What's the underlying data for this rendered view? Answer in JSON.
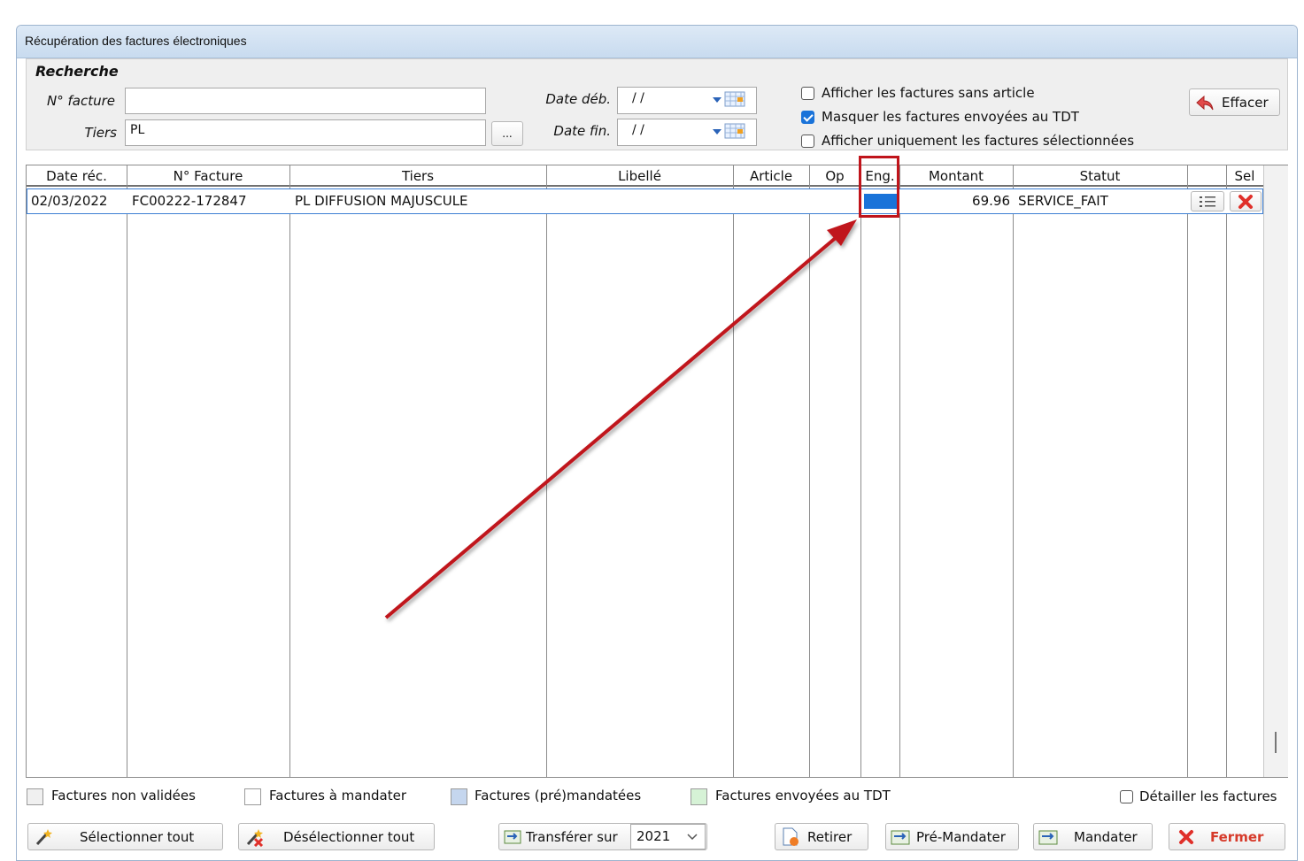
{
  "window": {
    "title": "Récupération des factures électroniques"
  },
  "search": {
    "section_title": "Recherche",
    "invoice_label": "N° facture",
    "invoice_value": "",
    "tiers_label": "Tiers",
    "tiers_value": "PL",
    "browse_label": "...",
    "date_start_label": "Date déb.",
    "date_start_value": "/ /",
    "date_end_label": "Date fin.",
    "date_end_value": "/ /",
    "clear_label": "Effacer",
    "options": [
      {
        "label": "Afficher les factures sans article",
        "checked": false
      },
      {
        "label": "Masquer les factures envoyées au TDT",
        "checked": true
      },
      {
        "label": "Afficher uniquement les factures sélectionnées",
        "checked": false
      }
    ]
  },
  "table": {
    "columns": [
      "Date réc.",
      "N° Facture",
      "Tiers",
      "Libellé",
      "Article",
      "Op",
      "Eng.",
      "Montant",
      "Statut",
      "",
      "Sel"
    ],
    "rows": [
      {
        "date": "02/03/2022",
        "invoice": "FC00222-172847",
        "tiers": "PL DIFFUSION MAJUSCULE",
        "libelle": "",
        "article": "",
        "op": "",
        "eng": "",
        "montant": "69.96",
        "statut": "SERVICE_FAIT"
      }
    ]
  },
  "legend": {
    "items": [
      {
        "label": "Factures non validées",
        "color": "#f0f0f0"
      },
      {
        "label": "Factures à mandater",
        "color": "#ffffff"
      },
      {
        "label": "Factures (pré)mandatées",
        "color": "#c5d6ee"
      },
      {
        "label": "Factures envoyées au TDT",
        "color": "#d6f2d6"
      }
    ],
    "detail_label": "Détailler les factures"
  },
  "actions": {
    "select_all": "Sélectionner tout",
    "deselect_all": "Désélectionner tout",
    "transfer": "Transférer sur",
    "year": "2021",
    "remove": "Retirer",
    "pre_mandate": "Pré-Mandater",
    "mandate": "Mandater",
    "close": "Fermer"
  },
  "colors": {
    "accent": "#1a73d9",
    "annotation": "#c0141b",
    "close_text": "#d63a2a"
  }
}
